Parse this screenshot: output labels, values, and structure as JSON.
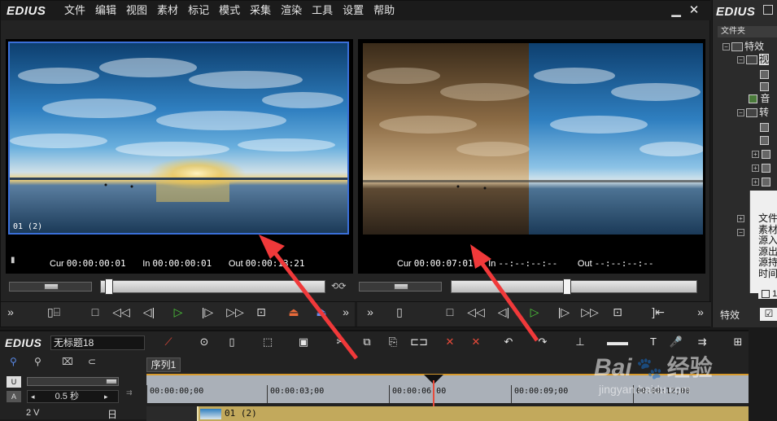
{
  "app": {
    "logo": "EDIUS",
    "menu": [
      "文件",
      "编辑",
      "视图",
      "素材",
      "标记",
      "模式",
      "采集",
      "渲染",
      "工具",
      "设置",
      "帮助"
    ],
    "minimize_glyph": "▁",
    "close_glyph": "✕"
  },
  "player": {
    "overlay_clip_label": "01 (2)",
    "cur_label": "Cur",
    "cur_value": "00:00:00:01",
    "in_label": "In",
    "in_value": "00:00:00:01",
    "out_label": "Out",
    "out_value": "00:00:13:21",
    "scrub_level": 0.02
  },
  "recorder": {
    "cur_label": "Cur",
    "cur_value": "00:00:07:01",
    "in_label": "In",
    "in_value": "--:--:--:--",
    "out_label": "Out",
    "out_value": "--:--:--:--",
    "scrub_level": 0.47
  },
  "right_panel": {
    "logo": "EDIUS",
    "tab_label": "文件夹",
    "tree": [
      {
        "label": "特效",
        "level": 0
      },
      {
        "label": "视",
        "level": 1
      },
      {
        "label": "",
        "level": 2
      },
      {
        "label": "",
        "level": 2
      },
      {
        "label": "",
        "level": 2
      },
      {
        "label": "音",
        "level": 1
      },
      {
        "label": "转",
        "level": 1
      }
    ],
    "info_lines": [
      "文件",
      "素材",
      "源入",
      "源出",
      "源持",
      "时间"
    ],
    "bottom_label": "特效",
    "item_number": "1"
  },
  "timeline": {
    "logo": "EDIUS",
    "project_name": "无标题18",
    "sequence_tab": "序列1",
    "zoom_label": "0.5 秒",
    "ruler_ticks": [
      "00:00:00;00",
      "00:00:03;00",
      "00:00:06;00",
      "00:00:09;00",
      "00:00:12;00"
    ],
    "track_name": "2 V",
    "clip_label": "01 (2)",
    "track_lock_glyph": "日"
  },
  "watermark": {
    "brand": "Bai",
    "brand_suffix": "经验",
    "url": "jingyan.baidu.com"
  },
  "colors": {
    "accent_green": "#4ccc3a",
    "playhead": "#e84a3a",
    "selection_blue": "#3a6fd8",
    "timeline_ruler": "#aab0b8",
    "clip_track": "#c2a95c"
  }
}
